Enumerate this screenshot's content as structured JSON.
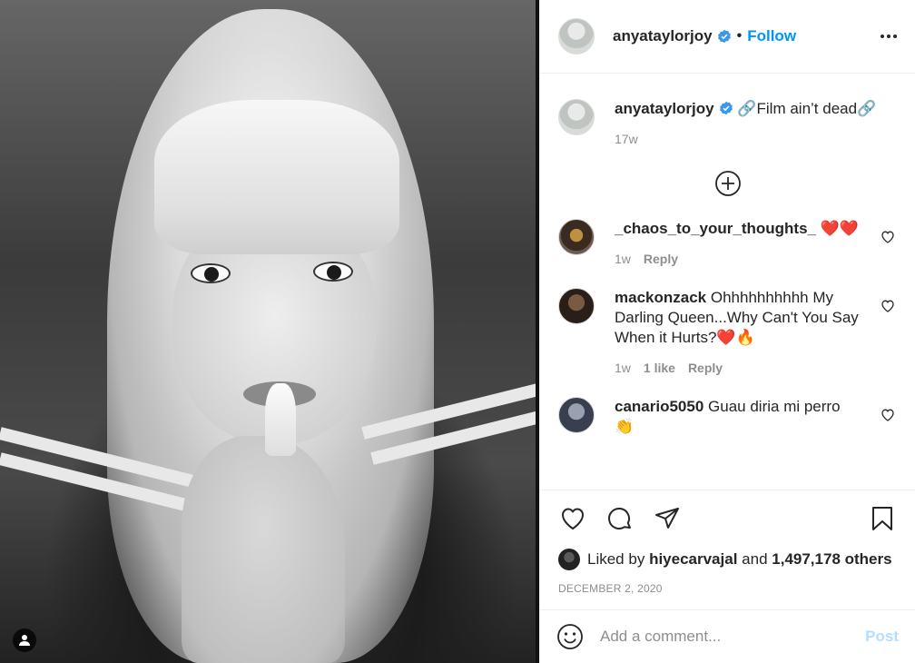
{
  "post": {
    "username": "anyataylorjoy",
    "follow_label": "Follow",
    "dot": "•",
    "verified": true
  },
  "caption": {
    "username": "anyataylorjoy",
    "text": "🔗Film ain’t dead🔗",
    "time": "17w"
  },
  "comments": [
    {
      "username": "_chaos_to_your_thoughts_",
      "text": "❤️❤️",
      "time": "1w",
      "reply": "Reply",
      "likes": ""
    },
    {
      "username": "mackonzack",
      "text": "Ohhhhhhhhhh My Darling Queen...Why Can't You Say When it Hurts?❤️🔥",
      "time": "1w",
      "likes": "1 like",
      "reply": "Reply"
    },
    {
      "username": "canario5050",
      "text": "Guau diria mi perro 👏",
      "time": "",
      "reply": "",
      "likes": ""
    }
  ],
  "likes": {
    "prefix": "Liked by",
    "user": "hiyecarvajal",
    "and": "and",
    "others": "1,497,178 others"
  },
  "date": "DECEMBER 2, 2020",
  "add_comment": {
    "placeholder": "Add a comment...",
    "post_label": "Post"
  },
  "colors": {
    "accent": "#0095f6",
    "post_disabled": "#b2dffc",
    "muted": "#8e8e8e"
  }
}
